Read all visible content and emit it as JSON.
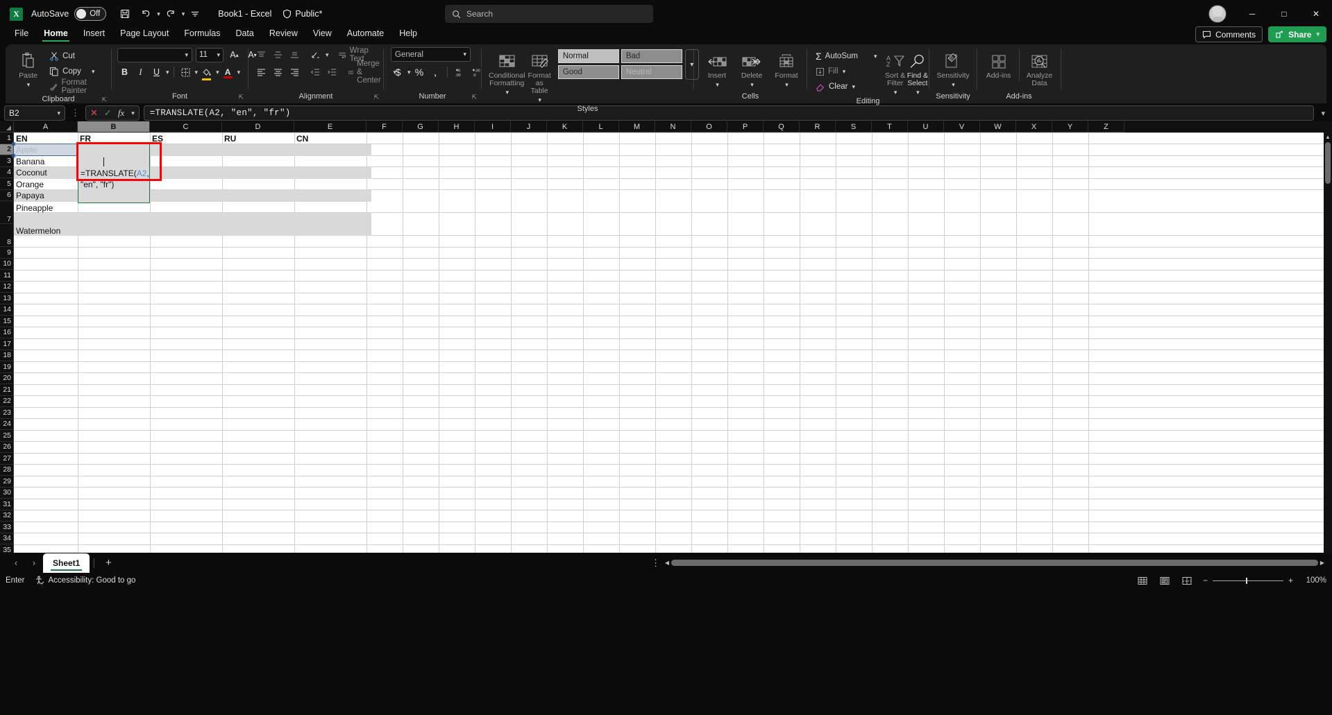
{
  "titlebar": {
    "app_logo": "excel-logo",
    "autosave_label": "AutoSave",
    "autosave_state": "Off",
    "save_icon": "save-icon",
    "undo_icon": "undo-icon",
    "redo_icon": "redo-icon",
    "customize_icon": "customize-quick-access-icon",
    "document_title": "Book1 - Excel",
    "sensitivity_label": "Public*",
    "search_placeholder": "Search",
    "minimize": "minimize-icon",
    "maximize": "maximize-icon",
    "close": "close-icon"
  },
  "ribbon": {
    "tabs": [
      {
        "label": "File",
        "active": false
      },
      {
        "label": "Home",
        "active": true
      },
      {
        "label": "Insert",
        "active": false
      },
      {
        "label": "Page Layout",
        "active": false
      },
      {
        "label": "Formulas",
        "active": false
      },
      {
        "label": "Data",
        "active": false
      },
      {
        "label": "Review",
        "active": false
      },
      {
        "label": "View",
        "active": false
      },
      {
        "label": "Automate",
        "active": false
      },
      {
        "label": "Help",
        "active": false
      }
    ],
    "comments_label": "Comments",
    "share_label": "Share",
    "groups": {
      "clipboard": {
        "label": "Clipboard",
        "paste": "Paste",
        "cut": "Cut",
        "copy": "Copy",
        "format_painter": "Format Painter"
      },
      "font": {
        "label": "Font",
        "font_name": "",
        "font_size": "11",
        "grow": "A",
        "shrink": "A",
        "bold": "B",
        "italic": "I",
        "underline": "U"
      },
      "alignment": {
        "label": "Alignment",
        "wrap_text": "Wrap Text",
        "merge_center": "Merge & Center"
      },
      "number": {
        "label": "Number",
        "format": "General",
        "currency": "$",
        "percent": "%",
        "comma": ","
      },
      "styles": {
        "label": "Styles",
        "conditional_formatting": "Conditional Formatting",
        "format_as_table": "Format as Table",
        "cell_styles": [
          "Normal",
          "Bad",
          "Good",
          "Neutral"
        ]
      },
      "cells": {
        "label": "Cells",
        "insert": "Insert",
        "delete": "Delete",
        "format": "Format"
      },
      "editing": {
        "label": "Editing",
        "autosum": "AutoSum",
        "fill": "Fill",
        "clear": "Clear",
        "sort_filter": "Sort & Filter",
        "find_select": "Find & Select"
      },
      "sensitivity": {
        "label": "Sensitivity",
        "button": "Sensitivity"
      },
      "addins": {
        "label": "Add-ins",
        "addins_button": "Add-ins",
        "analyze_data": "Analyze Data"
      }
    }
  },
  "formula_bar": {
    "name_box": "B2",
    "cancel_icon": "cancel-icon",
    "enter_icon": "confirm-icon",
    "insert_function_icon": "insert-function-icon",
    "formula": "=TRANSLATE(A2, \"en\", \"fr\")"
  },
  "grid": {
    "columns": [
      "A",
      "B",
      "C",
      "D",
      "E",
      "F",
      "G",
      "H",
      "I",
      "J",
      "K",
      "L",
      "M",
      "N",
      "O",
      "P",
      "Q",
      "R",
      "S",
      "T",
      "U",
      "V",
      "W",
      "X",
      "Y",
      "Z"
    ],
    "selected_column": "B",
    "rows": [
      "1",
      "2",
      "3",
      "4",
      "5",
      "6",
      "7",
      "8",
      "9",
      "10",
      "11",
      "12",
      "13",
      "14",
      "15",
      "16",
      "17",
      "18",
      "19",
      "20",
      "21",
      "22",
      "23",
      "24",
      "25",
      "26",
      "27",
      "28",
      "29",
      "30",
      "31",
      "32",
      "33",
      "34",
      "35"
    ],
    "selected_row": "2",
    "headers": {
      "A": "EN",
      "B": "FR",
      "C": "ES",
      "D": "RU",
      "E": "CN"
    },
    "column_a_values": [
      "Apple",
      "Banana",
      "Coconut",
      "Orange",
      "Papaya",
      "Pineapple",
      "Watermelon"
    ],
    "active_cell": "B2",
    "edit_text_prefix": "=TRANSLATE(",
    "edit_text_ref": "A2",
    "edit_text_suffix": ", \"en\", \"fr\")"
  },
  "sheetbar": {
    "prev_icon": "previous-sheet-icon",
    "next_icon": "next-sheet-icon",
    "tabs": [
      "Sheet1"
    ],
    "add_sheet": "add-sheet-icon"
  },
  "statusbar": {
    "mode": "Enter",
    "accessibility": "Accessibility: Good to go",
    "view_normal": "normal-view-icon",
    "view_pagelayout": "page-layout-view-icon",
    "view_pagebreak": "page-break-view-icon",
    "zoom_out": "−",
    "zoom_in": "+",
    "zoom_level": "100%"
  },
  "colors": {
    "accent_green": "#217346",
    "share_green": "#1d9c52",
    "selection_blue": "#2b579a",
    "highlight_red": "#ff0000",
    "ref_blue": "#4a90d9"
  }
}
